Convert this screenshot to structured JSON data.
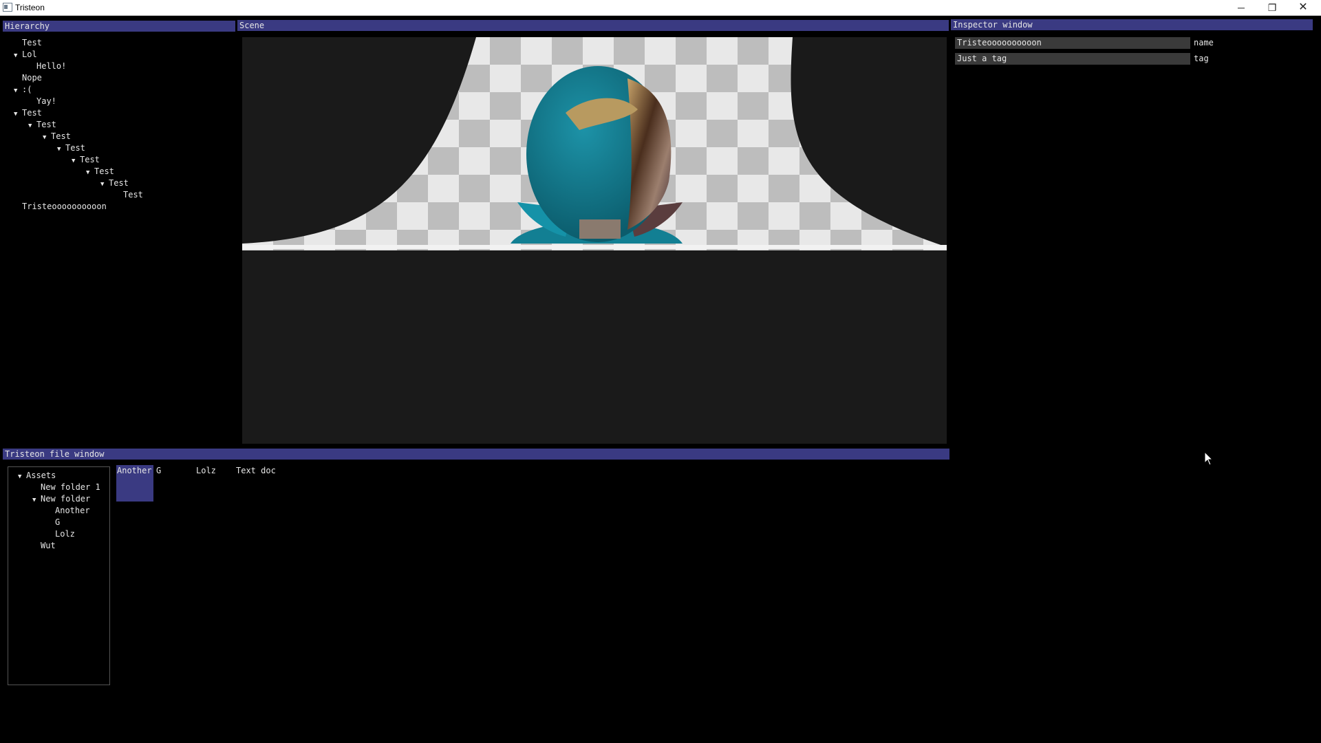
{
  "window": {
    "title": "Tristeon",
    "minimize_glyph": "─",
    "maximize_glyph": "❐",
    "close_glyph": "✕"
  },
  "hierarchy": {
    "title": "Hierarchy",
    "items": [
      {
        "label": "Test",
        "depth": 0,
        "expanded": false
      },
      {
        "label": "Lol",
        "depth": 0,
        "expanded": true
      },
      {
        "label": "Hello!",
        "depth": 1,
        "expanded": false
      },
      {
        "label": "Nope",
        "depth": 0,
        "expanded": false
      },
      {
        "label": ":(",
        "depth": 0,
        "expanded": true
      },
      {
        "label": "Yay!",
        "depth": 1,
        "expanded": false
      },
      {
        "label": "Test",
        "depth": 0,
        "expanded": true
      },
      {
        "label": "Test",
        "depth": 1,
        "expanded": true
      },
      {
        "label": "Test",
        "depth": 2,
        "expanded": true
      },
      {
        "label": "Test",
        "depth": 3,
        "expanded": true
      },
      {
        "label": "Test",
        "depth": 4,
        "expanded": true
      },
      {
        "label": "Test",
        "depth": 5,
        "expanded": true
      },
      {
        "label": "Test",
        "depth": 6,
        "expanded": true
      },
      {
        "label": "Test",
        "depth": 7,
        "expanded": false
      },
      {
        "label": "Tristeoooooooooon",
        "depth": 0,
        "expanded": false
      }
    ]
  },
  "scene": {
    "title": "Scene"
  },
  "inspector": {
    "title": "Inspector window",
    "fields": [
      {
        "value": "Tristeoooooooooon",
        "label": "name"
      },
      {
        "value": "Just a tag",
        "label": "tag"
      }
    ]
  },
  "file_window": {
    "title": "Tristeon file window",
    "tree": [
      {
        "label": "Assets",
        "depth": 0,
        "expanded": true
      },
      {
        "label": "New folder 1",
        "depth": 1,
        "expanded": false
      },
      {
        "label": "New folder",
        "depth": 1,
        "expanded": true
      },
      {
        "label": "Another",
        "depth": 2,
        "expanded": false
      },
      {
        "label": "G",
        "depth": 2,
        "expanded": false
      },
      {
        "label": "Lolz",
        "depth": 2,
        "expanded": false
      },
      {
        "label": "Wut",
        "depth": 1,
        "expanded": false
      }
    ],
    "files": [
      {
        "label": "Another",
        "selected": true
      },
      {
        "label": "G",
        "selected": false
      },
      {
        "label": "Lolz",
        "selected": false
      },
      {
        "label": "Text doc",
        "selected": false
      }
    ]
  },
  "colors": {
    "panel_title": "#3a3a82",
    "background": "#000000",
    "viewport": "#1a1a1a",
    "field": "#3a3a3a"
  },
  "icons": {
    "expanded_arrow": "▼",
    "app_icon": "window-icon",
    "cursor": "mouse-cursor-icon"
  }
}
